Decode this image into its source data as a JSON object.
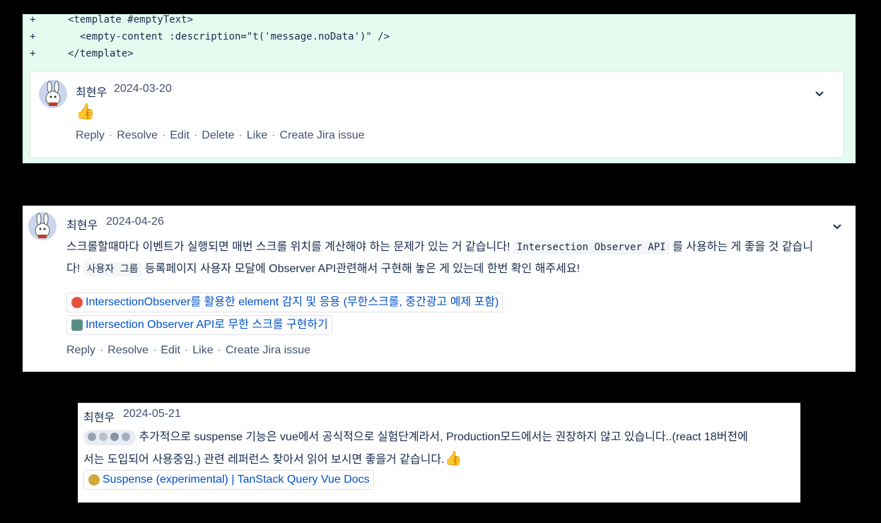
{
  "diff": {
    "lines": [
      {
        "sign": "+",
        "code": "<template #emptyText>"
      },
      {
        "sign": "+",
        "code": "  <empty-content :description=\"t('message.noData')\" />"
      },
      {
        "sign": "+",
        "code": "</template>"
      }
    ]
  },
  "comment1": {
    "author": "최현우",
    "date": "2024-03-20",
    "body_emoji": "👍",
    "actions": [
      "Reply",
      "Resolve",
      "Edit",
      "Delete",
      "Like",
      "Create Jira issue"
    ]
  },
  "comment2": {
    "author": "최현우",
    "date": "2024-04-26",
    "line1_pre": "스크롤할때마다 이벤트가 실행되면 매번 스크롤 위치를 계산해야 하는 문제가 있는 거 같습니다!",
    "line1_code": "Intersection Observer API",
    "line1_post": "를 사용하는 게 좋을 것 같습니",
    "line2_pre": "다!",
    "line2_code": "사용자 그룹",
    "line2_post": "등록페이지 사용자 모달에 Observer API관련해서 구현해 놓은 게 있는데 한번 확인 해주세요!",
    "links": [
      {
        "title": "IntersectionObserver를 활용한 element 감지 및 응용 (무한스크롤, 중간광고 예제 포함)",
        "favicon_color": "#e5533d"
      },
      {
        "title": "Intersection Observer API로 무한 스크롤 구현하기",
        "favicon_color": "#5a8d88"
      }
    ],
    "actions": [
      "Reply",
      "Resolve",
      "Edit",
      "Like",
      "Create Jira issue"
    ]
  },
  "comment3": {
    "author": "최현우",
    "date": "2024-05-21",
    "line1": "추가적으로 suspense 기능은 vue에서 공식적으로 실험단계라서, Production모드에서는 권장하지 않고 있습니다..(react 18버전에",
    "line2": "서는 도입되어 사용중임.) 관련 레퍼런스 찾아서 읽어 보시면 좋을거 같습니다.",
    "line2_emoji": "👍",
    "link": {
      "title": "Suspense (experimental) | TanStack Query Vue Docs",
      "favicon_color": "#d4a73a"
    }
  },
  "icons": {
    "chevron": "chevron-down-icon",
    "avatar": "avatar",
    "mention": "mention-tag"
  }
}
